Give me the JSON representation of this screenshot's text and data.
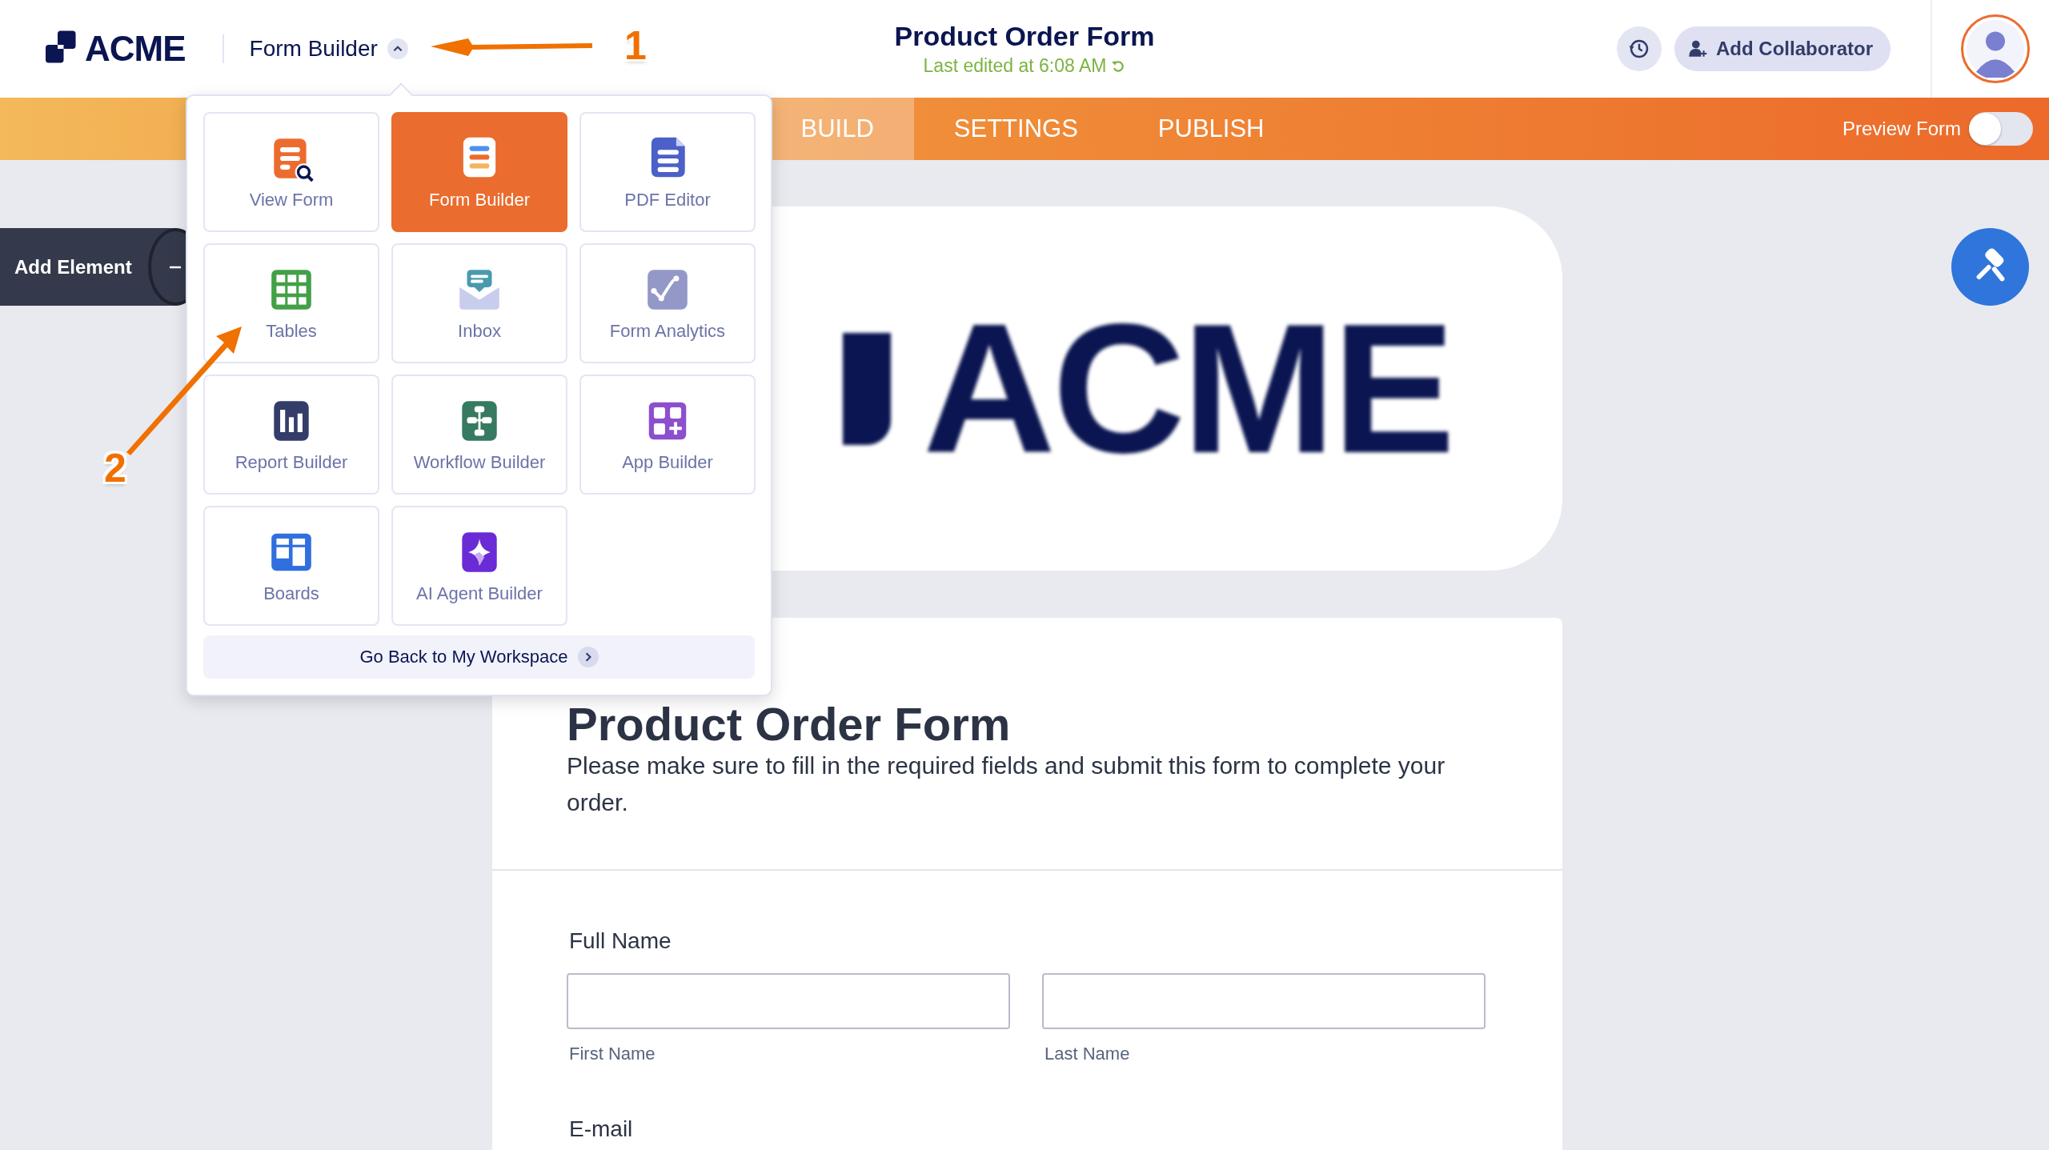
{
  "header": {
    "logo": "ACME",
    "app_switcher": {
      "label": "Form Builder",
      "expanded": true
    },
    "title": "Product Order Form",
    "subtitle": "Last edited at 6:08 AM",
    "collaborator_button": "Add Collaborator"
  },
  "nav": {
    "tabs": [
      {
        "label": "BUILD",
        "selected": true
      },
      {
        "label": "SETTINGS",
        "selected": false
      },
      {
        "label": "PUBLISH",
        "selected": false
      }
    ],
    "preview": {
      "label": "Preview Form",
      "on": false
    }
  },
  "app_menu": {
    "items": [
      {
        "label": "View Form",
        "kind": "view",
        "selected": false
      },
      {
        "label": "Form Builder",
        "kind": "form",
        "selected": true
      },
      {
        "label": "PDF Editor",
        "kind": "pdf",
        "selected": false
      },
      {
        "label": "Tables",
        "kind": "tables",
        "selected": false
      },
      {
        "label": "Inbox",
        "kind": "inbox",
        "selected": false
      },
      {
        "label": "Form Analytics",
        "kind": "analytics",
        "selected": false
      },
      {
        "label": "Report Builder",
        "kind": "report",
        "selected": false
      },
      {
        "label": "Workflow Builder",
        "kind": "workflow",
        "selected": false
      },
      {
        "label": "App Builder",
        "kind": "app",
        "selected": false
      },
      {
        "label": "Boards",
        "kind": "boards",
        "selected": false
      },
      {
        "label": "AI Agent Builder",
        "kind": "agent",
        "selected": false
      }
    ],
    "footer": "Go Back to My Workspace"
  },
  "sidebar": {
    "add_element": "Add Element"
  },
  "form": {
    "logo_text": "ACME",
    "title": "Product Order Form",
    "description": "Please make sure to fill in the required fields and submit this form to complete your order.",
    "fields": [
      {
        "kind": "name",
        "label": "Full Name",
        "subfields": [
          "First Name",
          "Last Name"
        ]
      },
      {
        "kind": "text",
        "label": "E-mail"
      }
    ]
  },
  "annotations": [
    {
      "number": "1"
    },
    {
      "number": "2"
    }
  ]
}
